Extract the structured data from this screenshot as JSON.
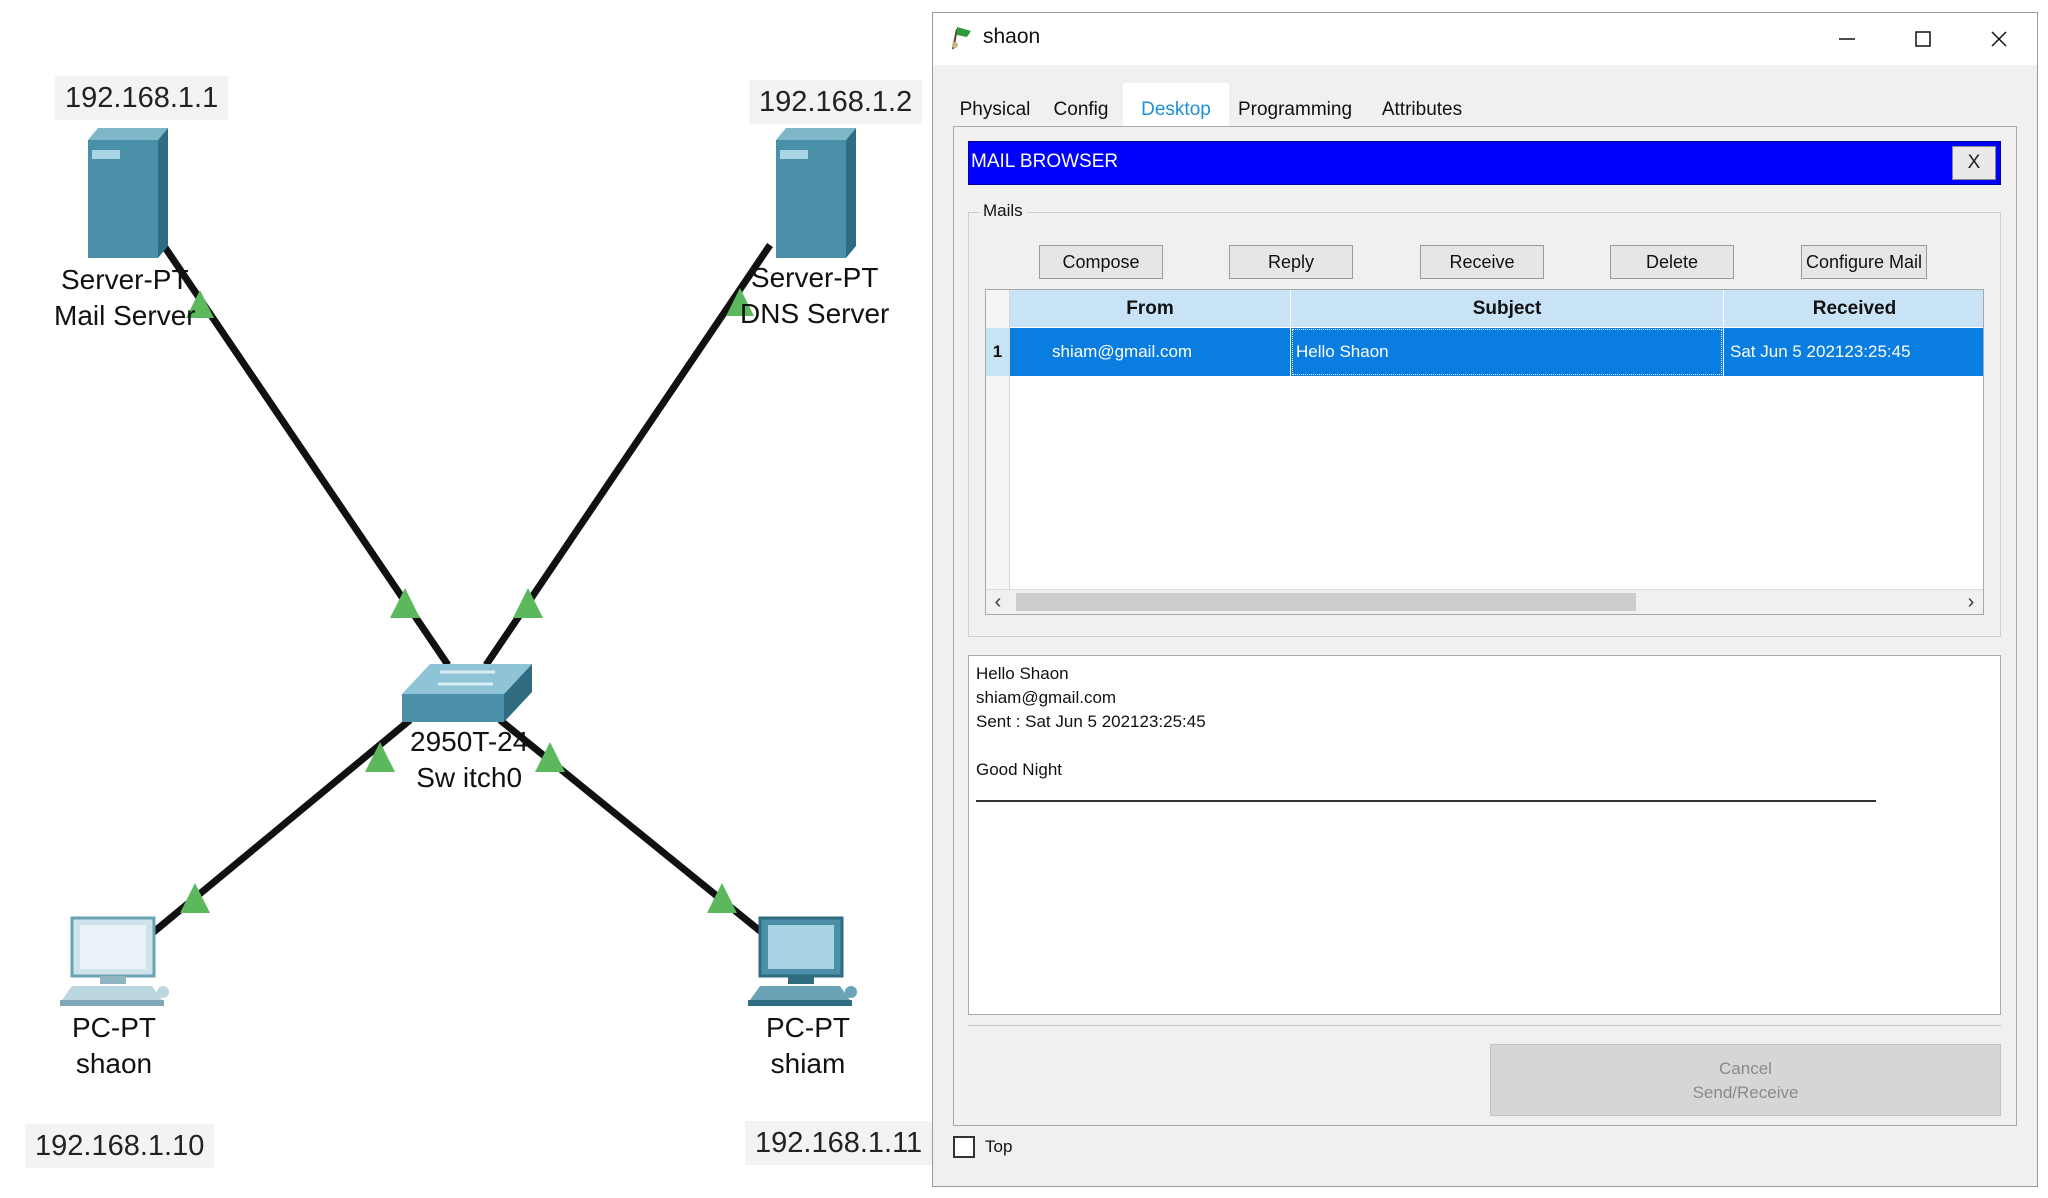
{
  "topology": {
    "servers": [
      {
        "ip": "192.168.1.1",
        "type": "Server-PT",
        "name": "Mail Server"
      },
      {
        "ip": "192.168.1.2",
        "type": "Server-PT",
        "name": "DNS Server"
      }
    ],
    "switch": {
      "model": "2950T-24",
      "name": "Sw itch0"
    },
    "pcs": [
      {
        "ip": "192.168.1.10",
        "type": "PC-PT",
        "name": "shaon"
      },
      {
        "ip": "192.168.1.11",
        "type": "PC-PT",
        "name": "shiam"
      }
    ],
    "colors": {
      "cable": "#111111",
      "link_up": "#5cb85c",
      "device": "#4a90a8"
    }
  },
  "window": {
    "title": "shaon",
    "tabs": [
      "Physical",
      "Config",
      "Desktop",
      "Programming",
      "Attributes"
    ],
    "active_tab": "Desktop"
  },
  "mail_browser": {
    "header": "MAIL BROWSER",
    "close_label": "X",
    "group_label": "Mails",
    "buttons": {
      "compose": "Compose",
      "reply": "Reply",
      "receive": "Receive",
      "delete": "Delete",
      "configure": "Configure Mail"
    },
    "columns": [
      "From",
      "Subject",
      "Received"
    ],
    "rows": [
      {
        "num": "1",
        "from": "shiam@gmail.com",
        "subject": "Hello Shaon",
        "received": "Sat Jun 5 202123:25:45"
      }
    ],
    "message": {
      "subject": "Hello Shaon",
      "from": "shiam@gmail.com",
      "sent": "Sent : Sat Jun 5 202123:25:45",
      "body": "Good Night"
    },
    "cancel_line1": "Cancel",
    "cancel_line2": "Send/Receive",
    "top_label": "Top",
    "colors": {
      "header_bg": "#0000ff",
      "selection": "#0a7de0",
      "column_header": "#c9e3f6",
      "active_tab": "#1f8fd6"
    }
  }
}
